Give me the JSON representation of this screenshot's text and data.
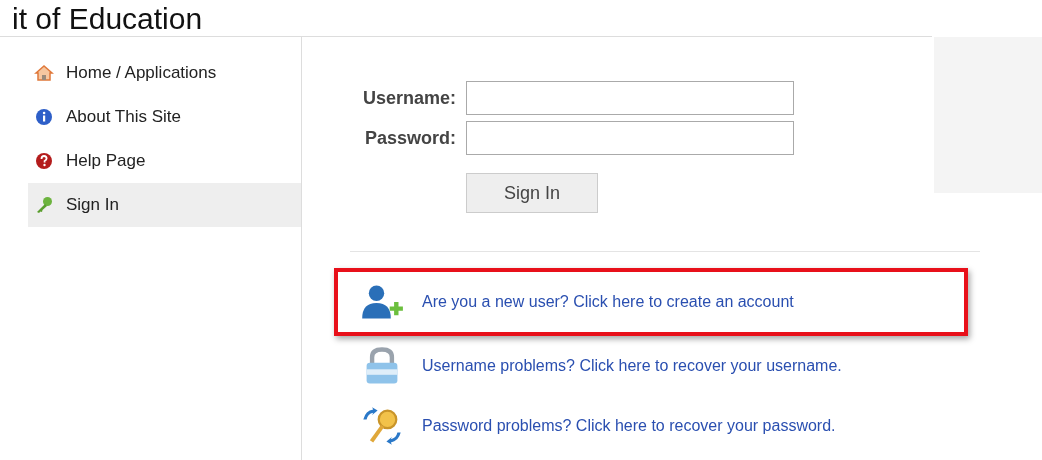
{
  "header": {
    "title": "it of Education"
  },
  "sidebar": {
    "items": [
      {
        "label": "Home / Applications",
        "kind": "home",
        "selected": false
      },
      {
        "label": "About This Site",
        "kind": "info",
        "selected": false
      },
      {
        "label": "Help Page",
        "kind": "help",
        "selected": false
      },
      {
        "label": "Sign In",
        "kind": "key",
        "selected": true
      }
    ]
  },
  "form": {
    "fields": [
      {
        "label": "Username:"
      },
      {
        "label": "Password:"
      }
    ],
    "button": "Sign In"
  },
  "links": [
    {
      "text": "Are you a new user? Click here to create an account",
      "kind": "new-user",
      "highlighted": true
    },
    {
      "text": "Username problems? Click here to recover your username.",
      "kind": "lock",
      "highlighted": false
    },
    {
      "text": "Password problems? Click here to recover your password.",
      "kind": "key-arrows",
      "highlighted": false
    }
  ]
}
